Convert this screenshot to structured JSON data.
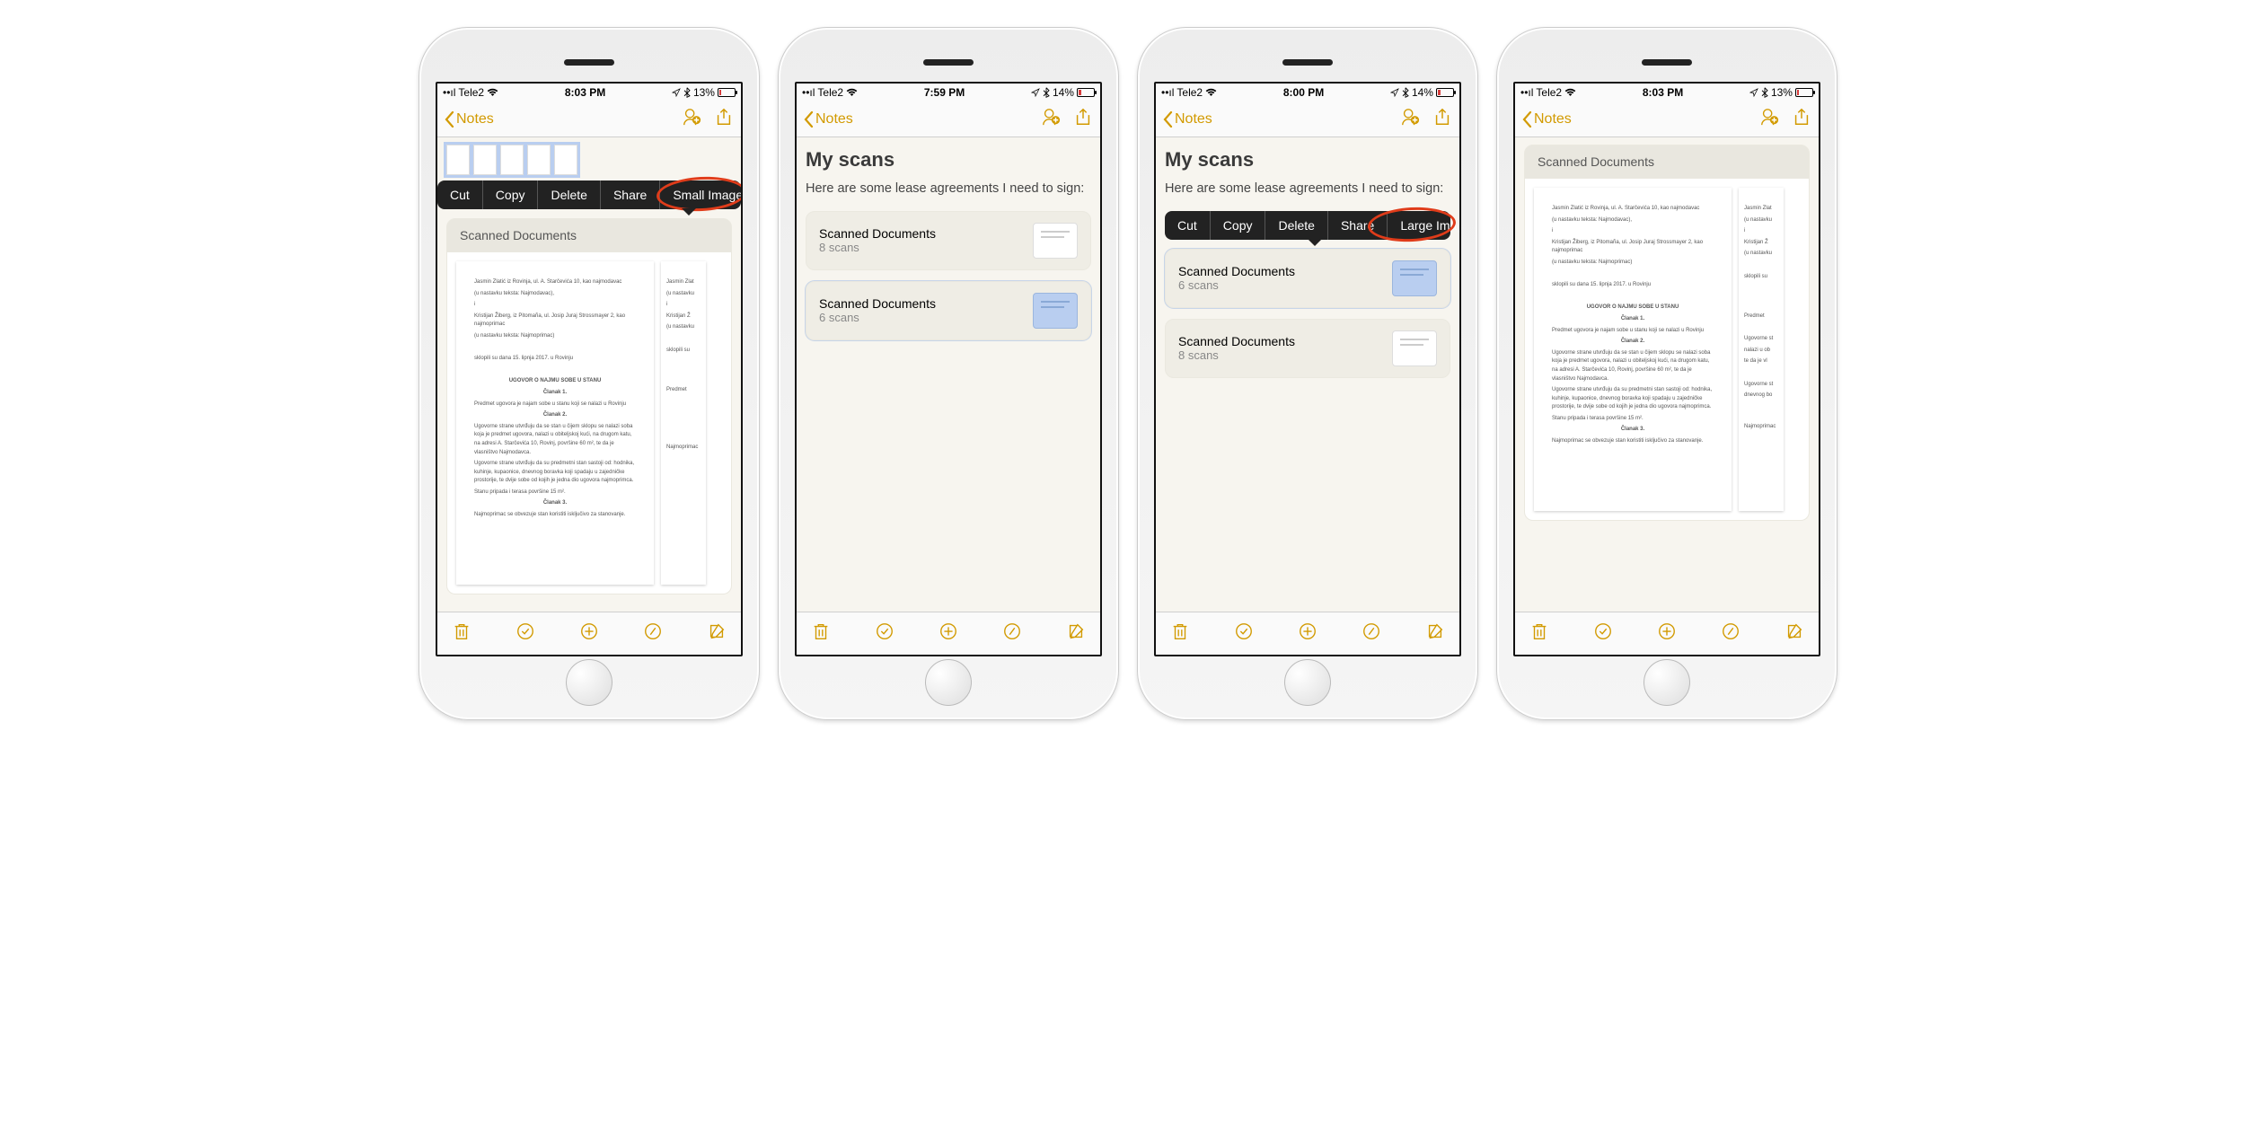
{
  "phones": [
    {
      "status": {
        "carrier": "Tele2",
        "time": "8:03 PM",
        "battery_pct": "13%"
      },
      "nav": {
        "back": "Notes"
      },
      "context_menu": {
        "items": [
          "Cut",
          "Copy",
          "Delete",
          "Share",
          "Small Images"
        ],
        "highlighted": "Small Images"
      },
      "attachment_title": "Scanned Documents",
      "doc": {
        "title": "UGOVOR O NAJMU SOBE U STANU",
        "heading": "Članak 1.",
        "line1": "Jasmin Zlatić iz Rovinja, ul. A. Starčevića 10, kao najmodavac",
        "line2": "(u nastavku teksta: Najmodavac),",
        "line3": "Kristijan Žiberg, iz Pitomaña, ul. Josip Juraj Strossmayer 2, kao najmoprimac",
        "line4": "(u nastavku teksta: Najmoprimac)",
        "line5": "sklopili su dana 15. lipnja 2017. u Rovinju",
        "line6": "Predmet ugovora je najam sobe u stanu koji se nalazi u Rovinju",
        "heading2": "Članak 2.",
        "para2": "Ugovorne strane utvrđuju da se stan u čijem sklopu se nalazi soba koja je predmet ugovora, nalazi u obiteljskoj kući, na drugom katu, na adresi A. Starčevića 10, Rovinj, površine 60 m², te da je vlasništvo Najmodavca.",
        "para3": "Ugovorne strane utvrđuju da su predmetni stan sastoji od: hodnika, kuhinje, kupaonice, dnevnog boravka koji spadaju u zajedničke prostorije, te dvije sobe od kojih je jedna dio ugovora najmoprimca.",
        "para4": "Stanu pripada i terasa površine 15 m².",
        "heading3": "Članak 3.",
        "para5": "Najmoprimac se obvezuje stan koristiti isključivo za stanovanje."
      }
    },
    {
      "status": {
        "carrier": "Tele2",
        "time": "7:59 PM",
        "battery_pct": "14%"
      },
      "nav": {
        "back": "Notes"
      },
      "note_title": "My scans",
      "note_text": "Here are some lease agreements I need to sign:",
      "entries": [
        {
          "title": "Scanned Documents",
          "sub": "8 scans",
          "selected": false
        },
        {
          "title": "Scanned Documents",
          "sub": "6 scans",
          "selected": true
        }
      ]
    },
    {
      "status": {
        "carrier": "Tele2",
        "time": "8:00 PM",
        "battery_pct": "14%"
      },
      "nav": {
        "back": "Notes"
      },
      "note_title": "My scans",
      "note_text": "Here are some lease agreements I need to sign:",
      "context_menu": {
        "items": [
          "Cut",
          "Copy",
          "Delete",
          "Share",
          "Large Images"
        ],
        "highlighted": "Large Images"
      },
      "entries": [
        {
          "title": "Scanned Documents",
          "sub": "6 scans",
          "selected": true
        },
        {
          "title": "Scanned Documents",
          "sub": "8 scans",
          "selected": false
        }
      ]
    },
    {
      "status": {
        "carrier": "Tele2",
        "time": "8:03 PM",
        "battery_pct": "13%"
      },
      "nav": {
        "back": "Notes"
      },
      "attachment_title": "Scanned Documents",
      "doc_ref": 0
    }
  ]
}
